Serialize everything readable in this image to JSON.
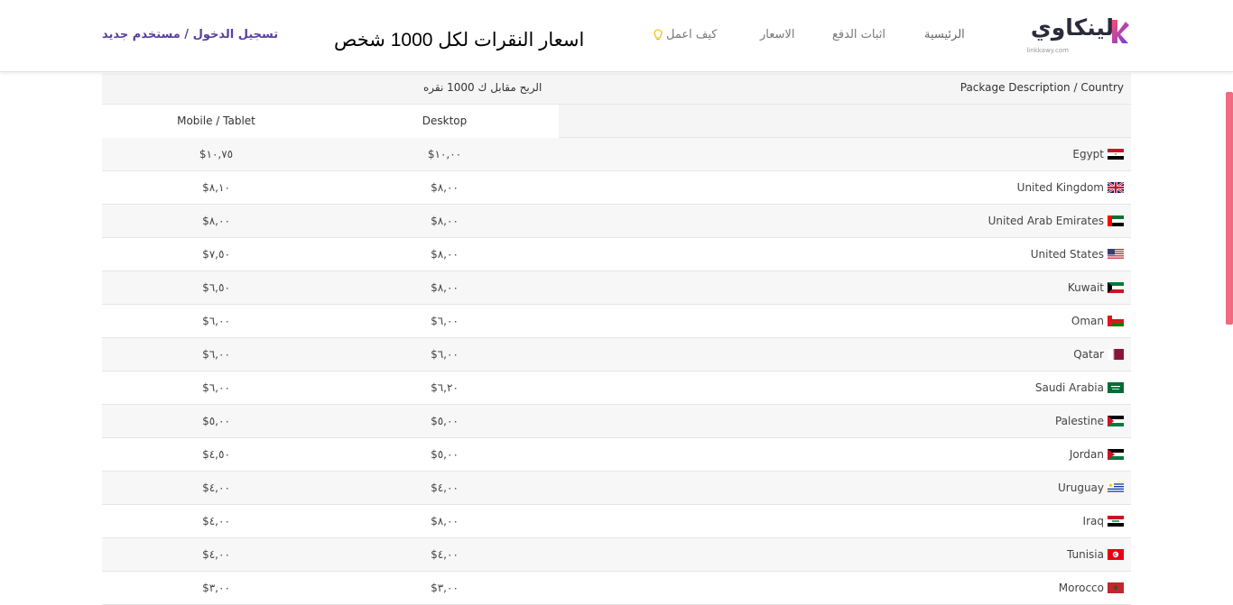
{
  "nav": {
    "logo_text": "لينكاوي",
    "logo_sub": "linkkawy.com",
    "items": [
      "الرئيسية",
      "اثبات الدفع",
      "الاسعار",
      "كيف اعمل"
    ],
    "heading": "اسعار النقرات لكل 1000 شخص",
    "auth": "تسجيل الدخول / مستخدم جديد"
  },
  "colors": {
    "accent": "#5a3e9c",
    "scrollbar": "#f06a82"
  },
  "table": {
    "country_header": "Package Description / Country",
    "group_header": "الربح مقابل ك 1000 نقره",
    "desktop_header": "Desktop",
    "mobile_header": "Mobile / Tablet",
    "rows": [
      {
        "country": "Egypt",
        "flag": "egypt-flag",
        "desktop": "$١٠,٠٠",
        "mobile": "$١٠,٧٥"
      },
      {
        "country": "United Kingdom",
        "flag": "uk-flag",
        "desktop": "$٨,٠٠",
        "mobile": "$٨,١٠"
      },
      {
        "country": "United Arab Emirates",
        "flag": "uae-flag",
        "desktop": "$٨,٠٠",
        "mobile": "$٨,٠٠"
      },
      {
        "country": "United States",
        "flag": "us-flag",
        "desktop": "$٨,٠٠",
        "mobile": "$٧,٥٠"
      },
      {
        "country": "Kuwait",
        "flag": "kuwait-flag",
        "desktop": "$٨,٠٠",
        "mobile": "$٦,٥٠"
      },
      {
        "country": "Oman",
        "flag": "oman-flag",
        "desktop": "$٦,٠٠",
        "mobile": "$٦,٠٠"
      },
      {
        "country": "Qatar",
        "flag": "qatar-flag",
        "desktop": "$٦,٠٠",
        "mobile": "$٦,٠٠"
      },
      {
        "country": "Saudi Arabia",
        "flag": "saudi-flag",
        "desktop": "$٦,٢٠",
        "mobile": "$٦,٠٠"
      },
      {
        "country": "Palestine",
        "flag": "palestine-flag",
        "desktop": "$٥,٠٠",
        "mobile": "$٥,٠٠"
      },
      {
        "country": "Jordan",
        "flag": "jordan-flag",
        "desktop": "$٥,٠٠",
        "mobile": "$٤,٥٠"
      },
      {
        "country": "Uruguay",
        "flag": "uruguay-flag",
        "desktop": "$٤,٠٠",
        "mobile": "$٤,٠٠"
      },
      {
        "country": "Iraq",
        "flag": "iraq-flag",
        "desktop": "$٨,٠٠",
        "mobile": "$٤,٠٠"
      },
      {
        "country": "Tunisia",
        "flag": "tunisia-flag",
        "desktop": "$٤,٠٠",
        "mobile": "$٤,٠٠"
      },
      {
        "country": "Morocco",
        "flag": "morocco-flag",
        "desktop": "$٣,٠٠",
        "mobile": "$٣,٠٠"
      }
    ]
  }
}
